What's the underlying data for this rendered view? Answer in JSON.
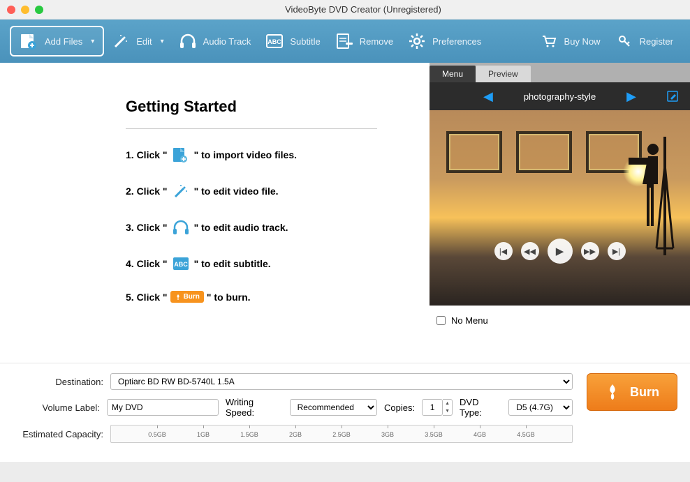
{
  "window": {
    "title": "VideoByte DVD Creator (Unregistered)"
  },
  "toolbar": {
    "add_files": "Add Files",
    "edit": "Edit",
    "audio_track": "Audio Track",
    "subtitle": "Subtitle",
    "remove": "Remove",
    "preferences": "Preferences",
    "buy_now": "Buy Now",
    "register": "Register"
  },
  "getting_started": {
    "title": "Getting Started",
    "steps": [
      {
        "pre": "1. Click \"",
        "post": "\" to import video files."
      },
      {
        "pre": "2. Click \"",
        "post": "\" to edit video file."
      },
      {
        "pre": "3. Click \"",
        "post": "\" to edit audio track."
      },
      {
        "pre": "4. Click \"",
        "post": "\" to edit subtitle."
      },
      {
        "pre": "5. Click \"",
        "post": "\" to burn.",
        "burn_label": "Burn"
      }
    ]
  },
  "preview": {
    "tabs": {
      "menu": "Menu",
      "preview": "Preview"
    },
    "style_name": "photography-style",
    "no_menu": "No Menu"
  },
  "settings": {
    "destination_label": "Destination:",
    "destination_value": "Optiarc BD RW BD-5740L 1.5A",
    "volume_label_label": "Volume Label:",
    "volume_label_value": "My DVD",
    "writing_speed_label": "Writing Speed:",
    "writing_speed_value": "Recommended",
    "copies_label": "Copies:",
    "copies_value": "1",
    "dvd_type_label": "DVD Type:",
    "dvd_type_value": "D5 (4.7G)",
    "estimated_capacity_label": "Estimated Capacity:",
    "ticks": [
      "0.5GB",
      "1GB",
      "1.5GB",
      "2GB",
      "2.5GB",
      "3GB",
      "3.5GB",
      "4GB",
      "4.5GB"
    ],
    "burn_button": "Burn"
  }
}
